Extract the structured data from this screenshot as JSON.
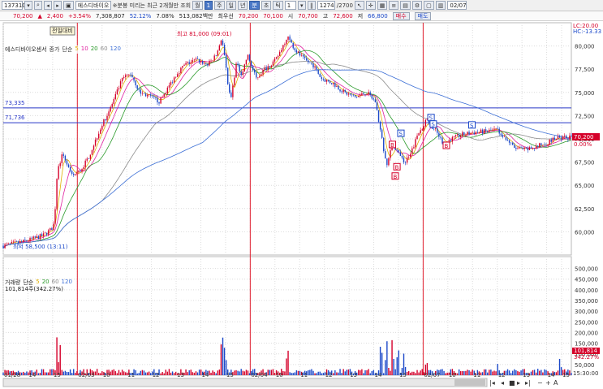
{
  "toolbar": {
    "code": "137310",
    "name": "에스디바이오",
    "notice": "※분봉 미리는 최근 2개월만 조회",
    "period_buttons": [
      "월",
      "1",
      "주",
      "일",
      "년",
      "분",
      "초",
      "틱"
    ],
    "active_period": "분",
    "interval": "1",
    "count": "1274",
    "count_total": "/2700",
    "date": "02/07"
  },
  "quote": {
    "price": "70,200",
    "change_sign": "▲",
    "change": "2,400",
    "change_pct": "+3.54%",
    "volume": "7,308,807",
    "volume_ratio": "52.12%",
    "turnover_rate": "7.08%",
    "amount": "513,082백만",
    "quote_type_label": "최우선",
    "best_ask": "70,200",
    "best_bid": "70,100",
    "open_label": "시",
    "open": "70,700",
    "high_label": "고",
    "high": "72,600",
    "low_label": "저",
    "low": "66,800",
    "buy_button": "매수",
    "sell_button": "매도"
  },
  "legend": {
    "name": "에스디바이오센서",
    "items": [
      "종가",
      "단순",
      "5",
      "10",
      "20",
      "60",
      "120"
    ],
    "volume_items": [
      "거래량",
      "단순",
      "5",
      "20",
      "60",
      "120"
    ],
    "volume_value": "101,814주(342.27%)"
  },
  "annotations": {
    "high": "최고 81,000 (09:01)",
    "low": "최저 58,500 (13:11)",
    "prev_day": "전일대비",
    "lc": "LC:20.00",
    "hc": "HC:-13.33",
    "hline_a": "73,335",
    "hline_b": "71,736",
    "price_tag": "70,200",
    "pct_tag": "0.00%",
    "vol_tag": "101,814",
    "vol_pct_tag": "342.27%",
    "time_end": "15:30:00"
  },
  "colors": {
    "up": "#d5002a",
    "down": "#1b48c9",
    "ma5": "#e0b000",
    "ma10": "#e020a0",
    "ma20": "#2a9a2a",
    "ma60": "#8c8c8c",
    "ma120": "#3c6fd6",
    "hline": "#2838c8",
    "vline": "#e02030",
    "grid": "#dcdcdc"
  },
  "chart_data": {
    "type": "candlestick",
    "title": "에스디바이오센서",
    "price_axis": [
      "80,000",
      "77,500",
      "75,000",
      "72,500",
      "70,000",
      "67,500",
      "65,000",
      "62,500",
      "60,000"
    ],
    "price_axis_values": [
      80000,
      77500,
      75000,
      72500,
      70000,
      67500,
      65000,
      62500,
      60000
    ],
    "price_range": [
      57500,
      82500
    ],
    "volume_axis": [
      "500,000",
      "450,000",
      "400,000",
      "350,000",
      "300,000",
      "250,000",
      "200,000",
      "150,000",
      "100,000",
      "50,000"
    ],
    "volume_axis_values": [
      500000,
      450000,
      400000,
      350000,
      300000,
      250000,
      200000,
      150000,
      100000,
      50000
    ],
    "volume_range": [
      0,
      525000
    ],
    "time_labels": [
      "01/28",
      "14",
      "15",
      "02/03",
      "10",
      "11",
      "12",
      "13",
      "14",
      "15",
      "02/04",
      "10",
      "11",
      "12",
      "13",
      "14",
      "15",
      "02/07",
      "10",
      "11",
      "12",
      "13",
      "14",
      "15"
    ],
    "day_separators": [
      "02/03",
      "02/04",
      "02/07"
    ],
    "price_path": [
      [
        0,
        58500
      ],
      [
        0.04,
        59000
      ],
      [
        0.07,
        59600
      ],
      [
        0.085,
        60300
      ],
      [
        0.09,
        61000
      ],
      [
        0.095,
        66500
      ],
      [
        0.105,
        68500
      ],
      [
        0.12,
        66000
      ],
      [
        0.135,
        66500
      ],
      [
        0.15,
        68000
      ],
      [
        0.17,
        71000
      ],
      [
        0.19,
        73500
      ],
      [
        0.21,
        76500
      ],
      [
        0.225,
        77000
      ],
      [
        0.24,
        75000
      ],
      [
        0.26,
        74500
      ],
      [
        0.275,
        74000
      ],
      [
        0.29,
        75500
      ],
      [
        0.305,
        77000
      ],
      [
        0.32,
        78000
      ],
      [
        0.34,
        78500
      ],
      [
        0.36,
        78000
      ],
      [
        0.375,
        79000
      ],
      [
        0.385,
        81000
      ],
      [
        0.39,
        78500
      ],
      [
        0.4,
        74000
      ],
      [
        0.41,
        78000
      ],
      [
        0.42,
        77000
      ],
      [
        0.43,
        79000
      ],
      [
        0.445,
        76500
      ],
      [
        0.46,
        77500
      ],
      [
        0.48,
        78500
      ],
      [
        0.5,
        81000
      ],
      [
        0.515,
        79500
      ],
      [
        0.53,
        78500
      ],
      [
        0.545,
        78000
      ],
      [
        0.56,
        76500
      ],
      [
        0.58,
        76000
      ],
      [
        0.6,
        75000
      ],
      [
        0.62,
        74500
      ],
      [
        0.64,
        75000
      ],
      [
        0.655,
        74000
      ],
      [
        0.665,
        70500
      ],
      [
        0.675,
        67000
      ],
      [
        0.685,
        69500
      ],
      [
        0.695,
        68500
      ],
      [
        0.705,
        67500
      ],
      [
        0.715,
        68000
      ],
      [
        0.73,
        70500
      ],
      [
        0.745,
        72000
      ],
      [
        0.76,
        71000
      ],
      [
        0.775,
        69500
      ],
      [
        0.79,
        70000
      ],
      [
        0.81,
        70500
      ],
      [
        0.83,
        70700
      ],
      [
        0.85,
        70800
      ],
      [
        0.87,
        71000
      ],
      [
        0.885,
        70000
      ],
      [
        0.9,
        69000
      ],
      [
        0.92,
        68800
      ],
      [
        0.94,
        69200
      ],
      [
        0.955,
        69500
      ],
      [
        0.97,
        70000
      ],
      [
        1.0,
        70200
      ]
    ],
    "volume_spikes": [
      [
        0.095,
        230000
      ],
      [
        0.1,
        160000
      ],
      [
        0.385,
        300000
      ],
      [
        0.39,
        170000
      ],
      [
        0.5,
        190000
      ],
      [
        0.665,
        210000
      ],
      [
        0.675,
        260000
      ],
      [
        0.685,
        280000
      ],
      [
        0.695,
        180000
      ],
      [
        0.705,
        160000
      ],
      [
        0.745,
        110000
      ],
      [
        0.87,
        60000
      ],
      [
        0.98,
        100000
      ]
    ],
    "horizontal_lines": [
      73335,
      71736
    ],
    "markers": [
      {
        "label": "S",
        "x": 0.7,
        "price": 70600
      },
      {
        "label": "B",
        "x": 0.685,
        "price": 69400
      },
      {
        "label": "B",
        "x": 0.693,
        "price": 67000
      },
      {
        "label": "B",
        "x": 0.69,
        "price": 66000
      },
      {
        "label": "S",
        "x": 0.753,
        "price": 72300
      },
      {
        "label": "S",
        "x": 0.757,
        "price": 71600
      },
      {
        "label": "B",
        "x": 0.78,
        "price": 69300
      },
      {
        "label": "S",
        "x": 0.825,
        "price": 71500
      }
    ]
  }
}
